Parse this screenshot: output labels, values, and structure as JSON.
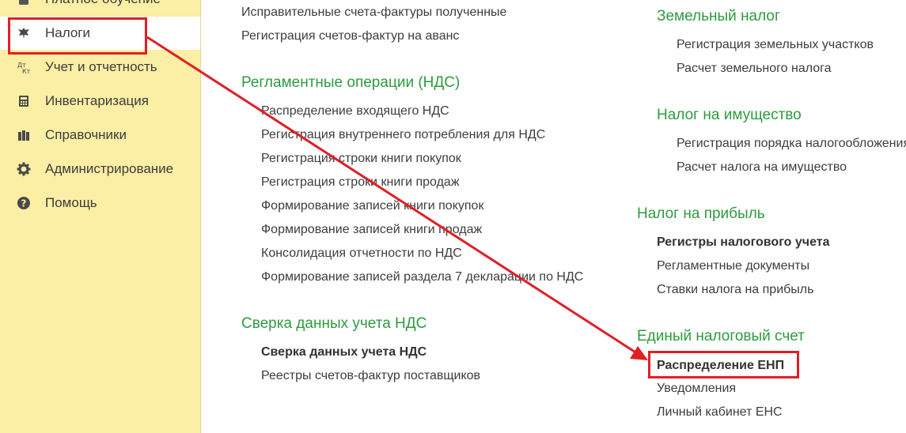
{
  "sidebar": {
    "items": [
      {
        "label": "Платное обучение",
        "icon": "book-icon"
      },
      {
        "label": "Налоги",
        "icon": "eagle-icon"
      },
      {
        "label": "Учет и отчетность",
        "icon": "report-icon"
      },
      {
        "label": "Инвентаризация",
        "icon": "inventory-icon"
      },
      {
        "label": "Справочники",
        "icon": "books-icon"
      },
      {
        "label": "Администрирование",
        "icon": "gear-icon"
      },
      {
        "label": "Помощь",
        "icon": "help-icon"
      }
    ]
  },
  "col1": {
    "top_items": [
      "Исправительные счета-фактуры полученные",
      "Регистрация счетов-фактур на аванс"
    ],
    "vat_ops": {
      "title": "Регламентные операции (НДС)",
      "items": [
        "Распределение входящего НДС",
        "Регистрация внутреннего потребления для НДС",
        "Регистрация строки книги покупок",
        "Регистрация строки книги продаж",
        "Формирование записей книги покупок",
        "Формирование записей книги продаж",
        "Консолидация отчетности по НДС",
        "Формирование записей раздела 7 декларации по НДС"
      ]
    },
    "vat_check": {
      "title": "Сверка данных учета НДС",
      "items": [
        "Сверка данных учета НДС",
        "Реестры счетов-фактур поставщиков"
      ]
    }
  },
  "col2": {
    "land": {
      "title": "Земельный налог",
      "items": [
        "Регистрация земельных участков",
        "Расчет земельного налога"
      ]
    },
    "property": {
      "title": "Налог на имущество",
      "items": [
        "Регистрация порядка налогообложения",
        "Расчет налога на имущество"
      ]
    },
    "profit": {
      "title": "Налог на прибыль",
      "items": [
        "Регистры налогового учета",
        "Регламентные документы",
        "Ставки налога на прибыль"
      ]
    },
    "ens": {
      "title": "Единый налоговый счет",
      "items": [
        "Распределение ЕНП",
        "Уведомления",
        "Личный кабинет ЕНС"
      ]
    }
  },
  "colors": {
    "sidebar_bg": "#fbeea5",
    "section_green": "#2e9b3f",
    "highlight_red": "#e01f26"
  }
}
